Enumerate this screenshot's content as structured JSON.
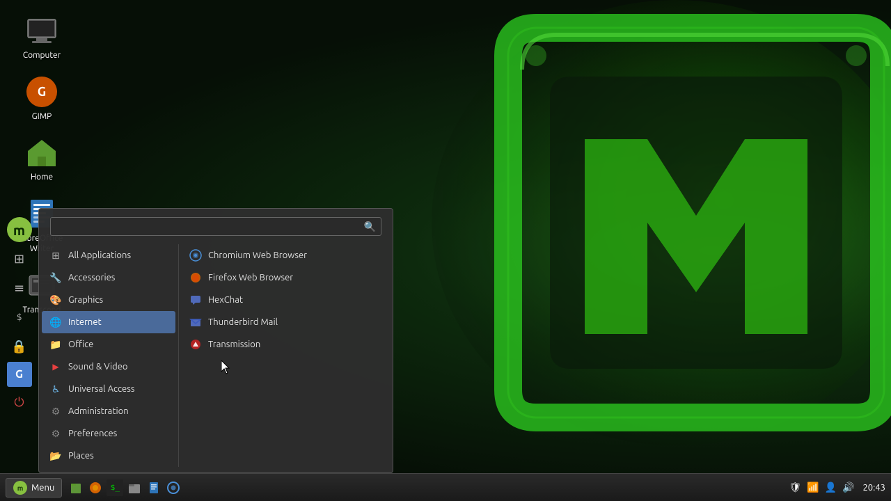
{
  "desktop": {
    "background": "#0a150a"
  },
  "taskbar": {
    "menu_label": "Menu",
    "time": "20:43"
  },
  "desktop_icons": [
    {
      "id": "computer",
      "label": "Computer",
      "icon": "🖥"
    },
    {
      "id": "gimp",
      "label": "GIMP",
      "icon": "🦊"
    },
    {
      "id": "home",
      "label": "Home",
      "icon": "🏠"
    },
    {
      "id": "writer",
      "label": "LibreOffice Writer",
      "icon": "📄"
    },
    {
      "id": "transcend",
      "label": "Transcend",
      "icon": "📋"
    }
  ],
  "app_menu": {
    "search_placeholder": "",
    "left_items": [
      {
        "id": "all-apps",
        "label": "All Applications",
        "icon": "⊞",
        "icon_color": "#aaa",
        "active": false
      },
      {
        "id": "accessories",
        "label": "Accessories",
        "icon": "🔧",
        "icon_color": "#6ab0e0",
        "active": false
      },
      {
        "id": "graphics",
        "label": "Graphics",
        "icon": "🎨",
        "icon_color": "#f0a000",
        "active": false
      },
      {
        "id": "internet",
        "label": "Internet",
        "icon": "🌐",
        "icon_color": "#4a90d9",
        "active": true
      },
      {
        "id": "office",
        "label": "Office",
        "icon": "📁",
        "icon_color": "#f0a000",
        "active": false
      },
      {
        "id": "sound-video",
        "label": "Sound & Video",
        "icon": "▶",
        "icon_color": "#e84040",
        "active": false
      },
      {
        "id": "universal-access",
        "label": "Universal Access",
        "icon": "♿",
        "icon_color": "#6ab0e0",
        "active": false
      },
      {
        "id": "administration",
        "label": "Administration",
        "icon": "⚙",
        "icon_color": "#888",
        "active": false
      },
      {
        "id": "preferences",
        "label": "Preferences",
        "icon": "⚙",
        "icon_color": "#888",
        "active": false
      },
      {
        "id": "places",
        "label": "Places",
        "icon": "📂",
        "icon_color": "#6db33f",
        "active": false
      }
    ],
    "right_items": [
      {
        "id": "chromium",
        "label": "Chromium Web Browser",
        "icon": "◎",
        "icon_color": "#4a90d9"
      },
      {
        "id": "firefox",
        "label": "Firefox Web Browser",
        "icon": "🦊",
        "icon_color": "#e86a00"
      },
      {
        "id": "hexchat",
        "label": "HexChat",
        "icon": "💬",
        "icon_color": "#5a8adf"
      },
      {
        "id": "thunderbird",
        "label": "Thunderbird Mail",
        "icon": "✉",
        "icon_color": "#5a8adf"
      },
      {
        "id": "transmission",
        "label": "Transmission",
        "icon": "⬇",
        "icon_color": "#cc2222"
      }
    ]
  },
  "sidebar": {
    "items": [
      {
        "id": "mint",
        "icon": "m",
        "color": "#87c040"
      },
      {
        "id": "apps",
        "icon": "⊞"
      },
      {
        "id": "list",
        "icon": "≡"
      },
      {
        "id": "terminal",
        "icon": ">_"
      },
      {
        "id": "lock",
        "icon": "🔒"
      },
      {
        "id": "g",
        "icon": "G"
      },
      {
        "id": "power",
        "icon": "⏻"
      }
    ]
  },
  "tray": {
    "icons": [
      "🛡",
      "📶",
      "🔊"
    ],
    "time": "20:43"
  }
}
